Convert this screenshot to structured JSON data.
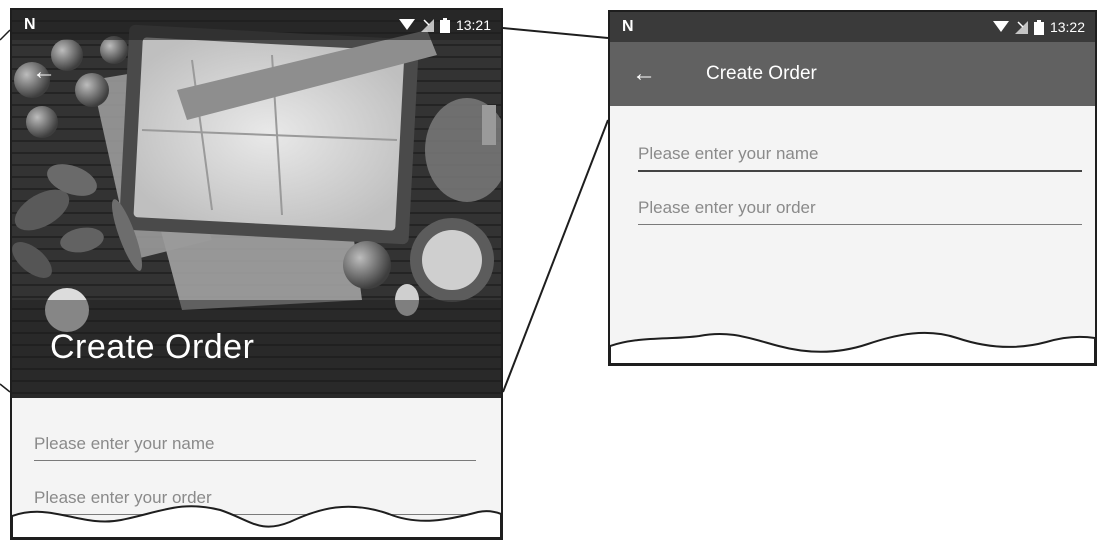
{
  "left_screen": {
    "status_bar": {
      "carrier_logo": "N",
      "wifi_icon": "wifi-icon",
      "signal_icon": "no-signal-icon",
      "battery_icon": "battery-icon",
      "time": "13:21"
    },
    "back_icon": "←",
    "title": "Create Order",
    "name_placeholder": "Please enter your name",
    "order_placeholder": "Please enter your order"
  },
  "right_screen": {
    "status_bar": {
      "carrier_logo": "N",
      "wifi_icon": "wifi-icon",
      "signal_icon": "no-signal-icon",
      "battery_icon": "battery-icon",
      "time": "13:22"
    },
    "back_icon": "←",
    "title": "Create Order",
    "name_placeholder": "Please enter your name",
    "order_placeholder": "Please enter your order"
  },
  "colors": {
    "toolbar": "#616161",
    "status_bar": "#3a3a3a",
    "background": "#f4f4f4"
  }
}
